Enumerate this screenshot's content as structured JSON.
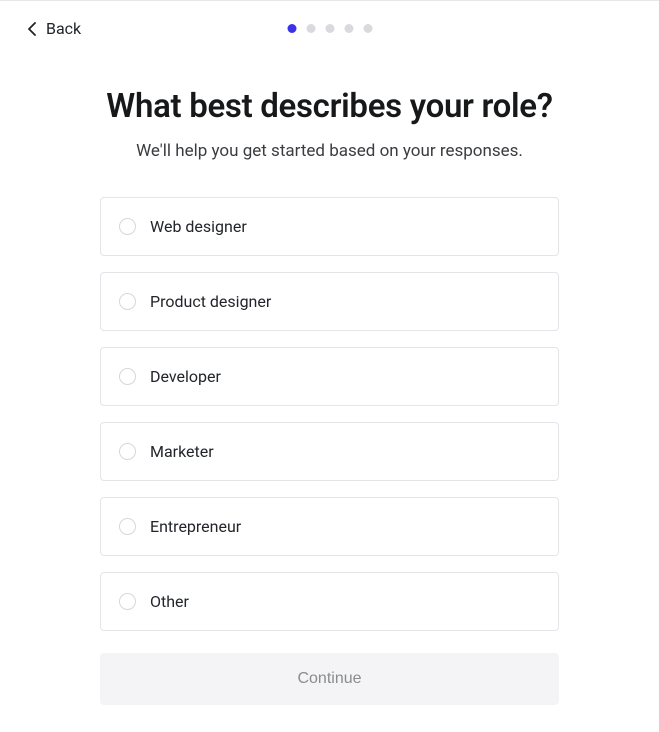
{
  "header": {
    "back_label": "Back"
  },
  "progress": {
    "total_steps": 5,
    "active_index": 0
  },
  "title": "What best describes your role?",
  "subtitle": "We'll help you get started based on your responses.",
  "options": [
    {
      "label": "Web designer"
    },
    {
      "label": "Product designer"
    },
    {
      "label": "Developer"
    },
    {
      "label": "Marketer"
    },
    {
      "label": "Entrepreneur"
    },
    {
      "label": "Other"
    }
  ],
  "continue_label": "Continue"
}
